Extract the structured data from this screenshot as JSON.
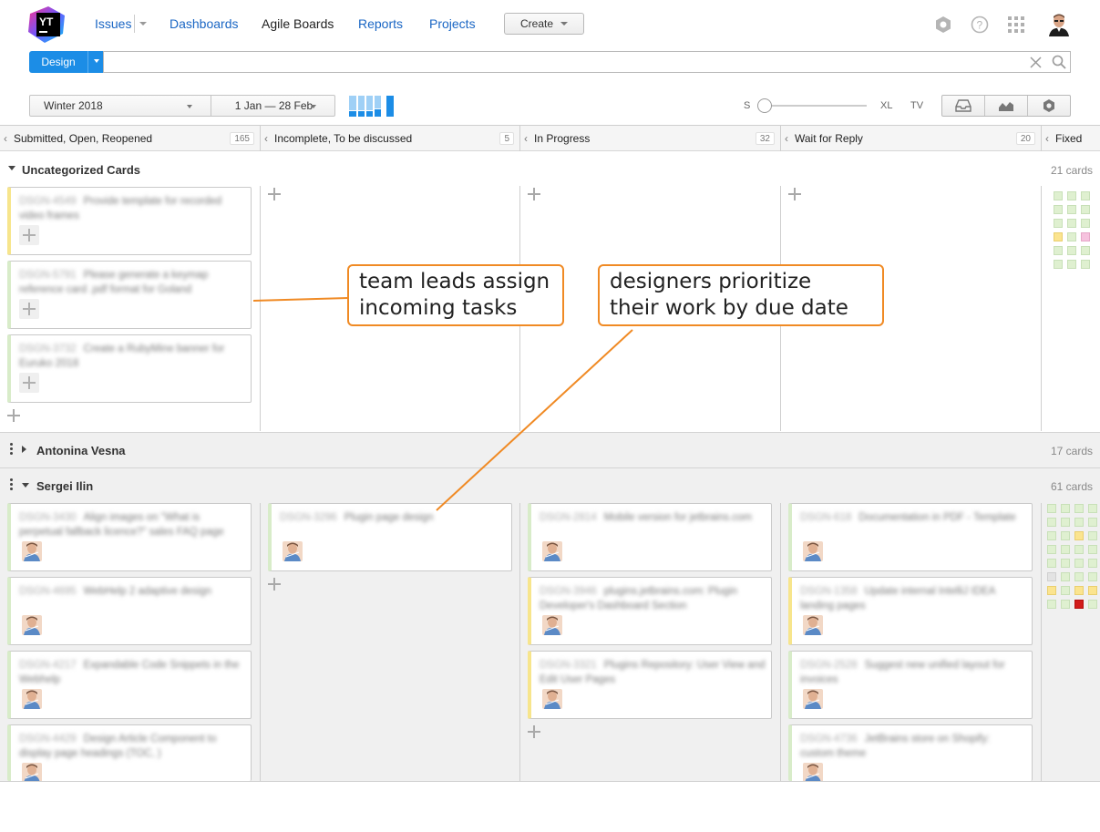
{
  "nav": {
    "logo_text": "YT",
    "issues": "Issues",
    "dashboards": "Dashboards",
    "agile_boards": "Agile Boards",
    "reports": "Reports",
    "projects": "Projects",
    "create": "Create"
  },
  "search": {
    "context": "Design",
    "value": "",
    "placeholder": ""
  },
  "toolbar": {
    "sprint": "Winter 2018",
    "date_range": "1 Jan — 28 Feb",
    "size_small": "S",
    "size_xl": "XL",
    "size_tv": "TV"
  },
  "columns": [
    {
      "title": "Submitted, Open, Reopened",
      "count": "165"
    },
    {
      "title": "Incomplete, To be discussed",
      "count": "5"
    },
    {
      "title": "In Progress",
      "count": "32"
    },
    {
      "title": "Wait for Reply",
      "count": "20"
    },
    {
      "title": "Fixed",
      "count": ""
    }
  ],
  "swimlanes": {
    "uncategorized": {
      "title": "Uncategorized Cards",
      "count": "21 cards"
    },
    "antonina": {
      "title": "Antonina Vesna",
      "count": "17 cards"
    },
    "sergei": {
      "title": "Sergei Ilin",
      "count": "61 cards"
    }
  },
  "uncategorized_cards": [
    {
      "id": "DSGN-4549",
      "summary": "Provide template for recorded video frames"
    },
    {
      "id": "DSGN-5791",
      "summary": "Please generate a keymap reference card .pdf format for Goland"
    },
    {
      "id": "DSGN-3732",
      "summary": "Create a RubyMine banner for Euruko 2018"
    }
  ],
  "sergei_cards": {
    "col1": [
      {
        "id": "DSGN-3430",
        "summary": "Align images on \"What is perpetual fallback licence?\" sales FAQ page"
      },
      {
        "id": "DSGN-4695",
        "summary": "WebHelp 2 adaptive design"
      },
      {
        "id": "DSGN-4217",
        "summary": "Expandable Code Snippets in the Webhelp"
      },
      {
        "id": "DSGN-4429",
        "summary": "Design Article Component to display page headings (TOC, )"
      }
    ],
    "col2": [
      {
        "id": "DSGN-3296",
        "summary": "Plugin page design"
      }
    ],
    "col3": [
      {
        "id": "DSGN-2814",
        "summary": "Mobile version for jetbrains.com"
      },
      {
        "id": "DSGN-3946",
        "summary": "plugins.jetbrains.com: Plugin Developer's Dashboard Section"
      },
      {
        "id": "DSGN-3321",
        "summary": "Plugins Repository: User View and Edit User Pages"
      }
    ],
    "col4": [
      {
        "id": "DSGN-618",
        "summary": "Documentation in PDF - Template"
      },
      {
        "id": "DSGN-1358",
        "summary": "Update internal IntelliJ IDEA landing pages"
      },
      {
        "id": "DSGN-2528",
        "summary": "Suggest new unified layout for invoices"
      },
      {
        "id": "DSGN-4736",
        "summary": "JetBrains store on Shopify: custom theme"
      }
    ]
  },
  "callouts": {
    "team_leads": "team leads assign\nincoming tasks",
    "designers": "designers prioritize\ntheir work by due date"
  },
  "colors": {
    "accent": "#1c8de6",
    "link": "#1a66c4",
    "callout_border": "#f08a24",
    "card_stripe_green": "#d8ecc9",
    "card_stripe_yellow": "#f7e58c"
  },
  "icons": {
    "logo": "youtrack-logo",
    "settings": "gear-icon",
    "help": "help-icon",
    "apps": "apps-grid-icon",
    "user": "user-avatar",
    "clear": "close-icon",
    "search": "search-icon",
    "backlog": "inbox-icon",
    "chart": "burndown-chart-icon",
    "board_settings": "gear-icon"
  }
}
